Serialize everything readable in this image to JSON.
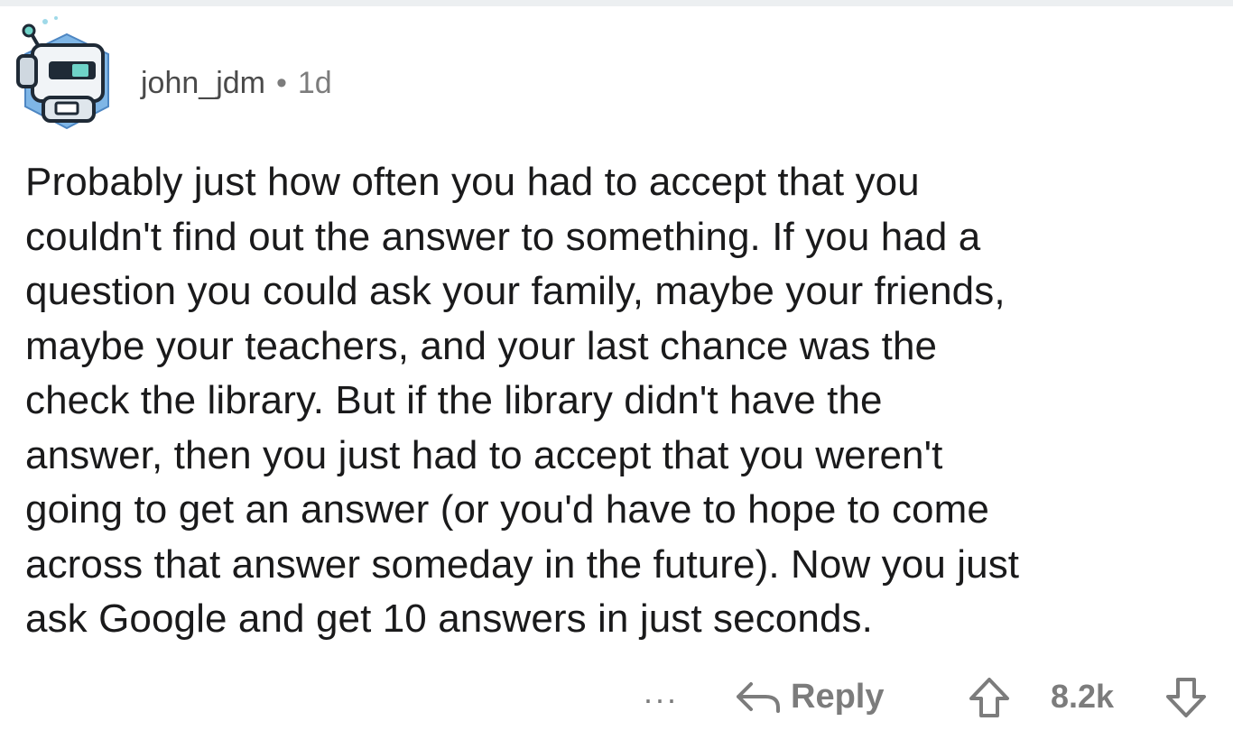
{
  "comment": {
    "username": "john_jdm",
    "separator": "•",
    "age": "1d",
    "avatar_icon": "robot-avatar-icon",
    "body_lines": [
      "Probably just how often you had to accept that you",
      "couldn't find out the answer to something. If you had a",
      "question you could ask your family, maybe your friends,",
      "maybe your teachers, and your last chance was the",
      "check the library. But if the library didn't have the",
      "answer, then you just had to accept that you weren't",
      "going to get an answer (or you'd have to hope to come",
      "across that answer someday in the future). Now you just",
      "ask Google and get 10 answers in just seconds."
    ]
  },
  "actions": {
    "more_label": "···",
    "reply_label": "Reply",
    "score": "8.2k",
    "icons": {
      "more": "more-options-icon",
      "reply": "reply-arrow-icon",
      "upvote": "upvote-arrow-icon",
      "downvote": "downvote-arrow-icon"
    }
  },
  "colors": {
    "text": "#1a1a1b",
    "meta": "#7c7c7c",
    "avatar_bg": "#7fb6e6"
  }
}
